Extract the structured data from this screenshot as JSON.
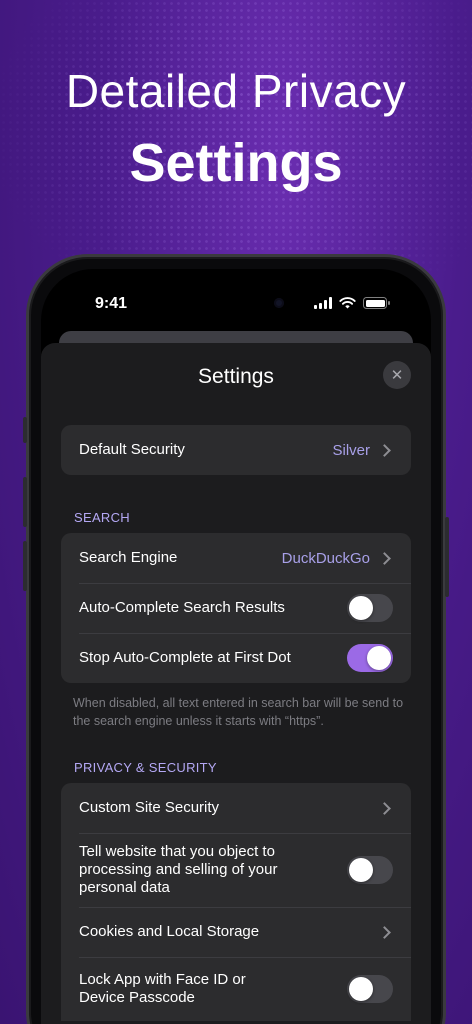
{
  "headline": {
    "line1": "Detailed Privacy",
    "line2": "Settings"
  },
  "status_bar": {
    "time": "9:41"
  },
  "sheet": {
    "title": "Settings"
  },
  "default_security": {
    "label": "Default Security",
    "value": "Silver"
  },
  "search": {
    "header": "SEARCH",
    "engine_label": "Search Engine",
    "engine_value": "DuckDuckGo",
    "autocomplete_label": "Auto-Complete Search Results",
    "autocomplete_on": false,
    "stop_dot_label": "Stop Auto-Complete at First Dot",
    "stop_dot_on": true,
    "footnote": "When disabled, all text entered in search bar will be send to the search engine unless it starts with “https”."
  },
  "privacy": {
    "header": "PRIVACY & SECURITY",
    "custom_site_label": "Custom Site Security",
    "object_processing_label": "Tell website that you object to processing and selling of your personal data",
    "object_processing_on": false,
    "cookies_label": "Cookies and Local Storage",
    "lock_app_label": "Lock App with Face ID or Device Passcode",
    "lock_app_on": false
  },
  "colors": {
    "accent": "#9b6ae6",
    "link_value": "#a8a0e8",
    "section_header": "#b4a8f4",
    "background": "#4a1c8c"
  }
}
